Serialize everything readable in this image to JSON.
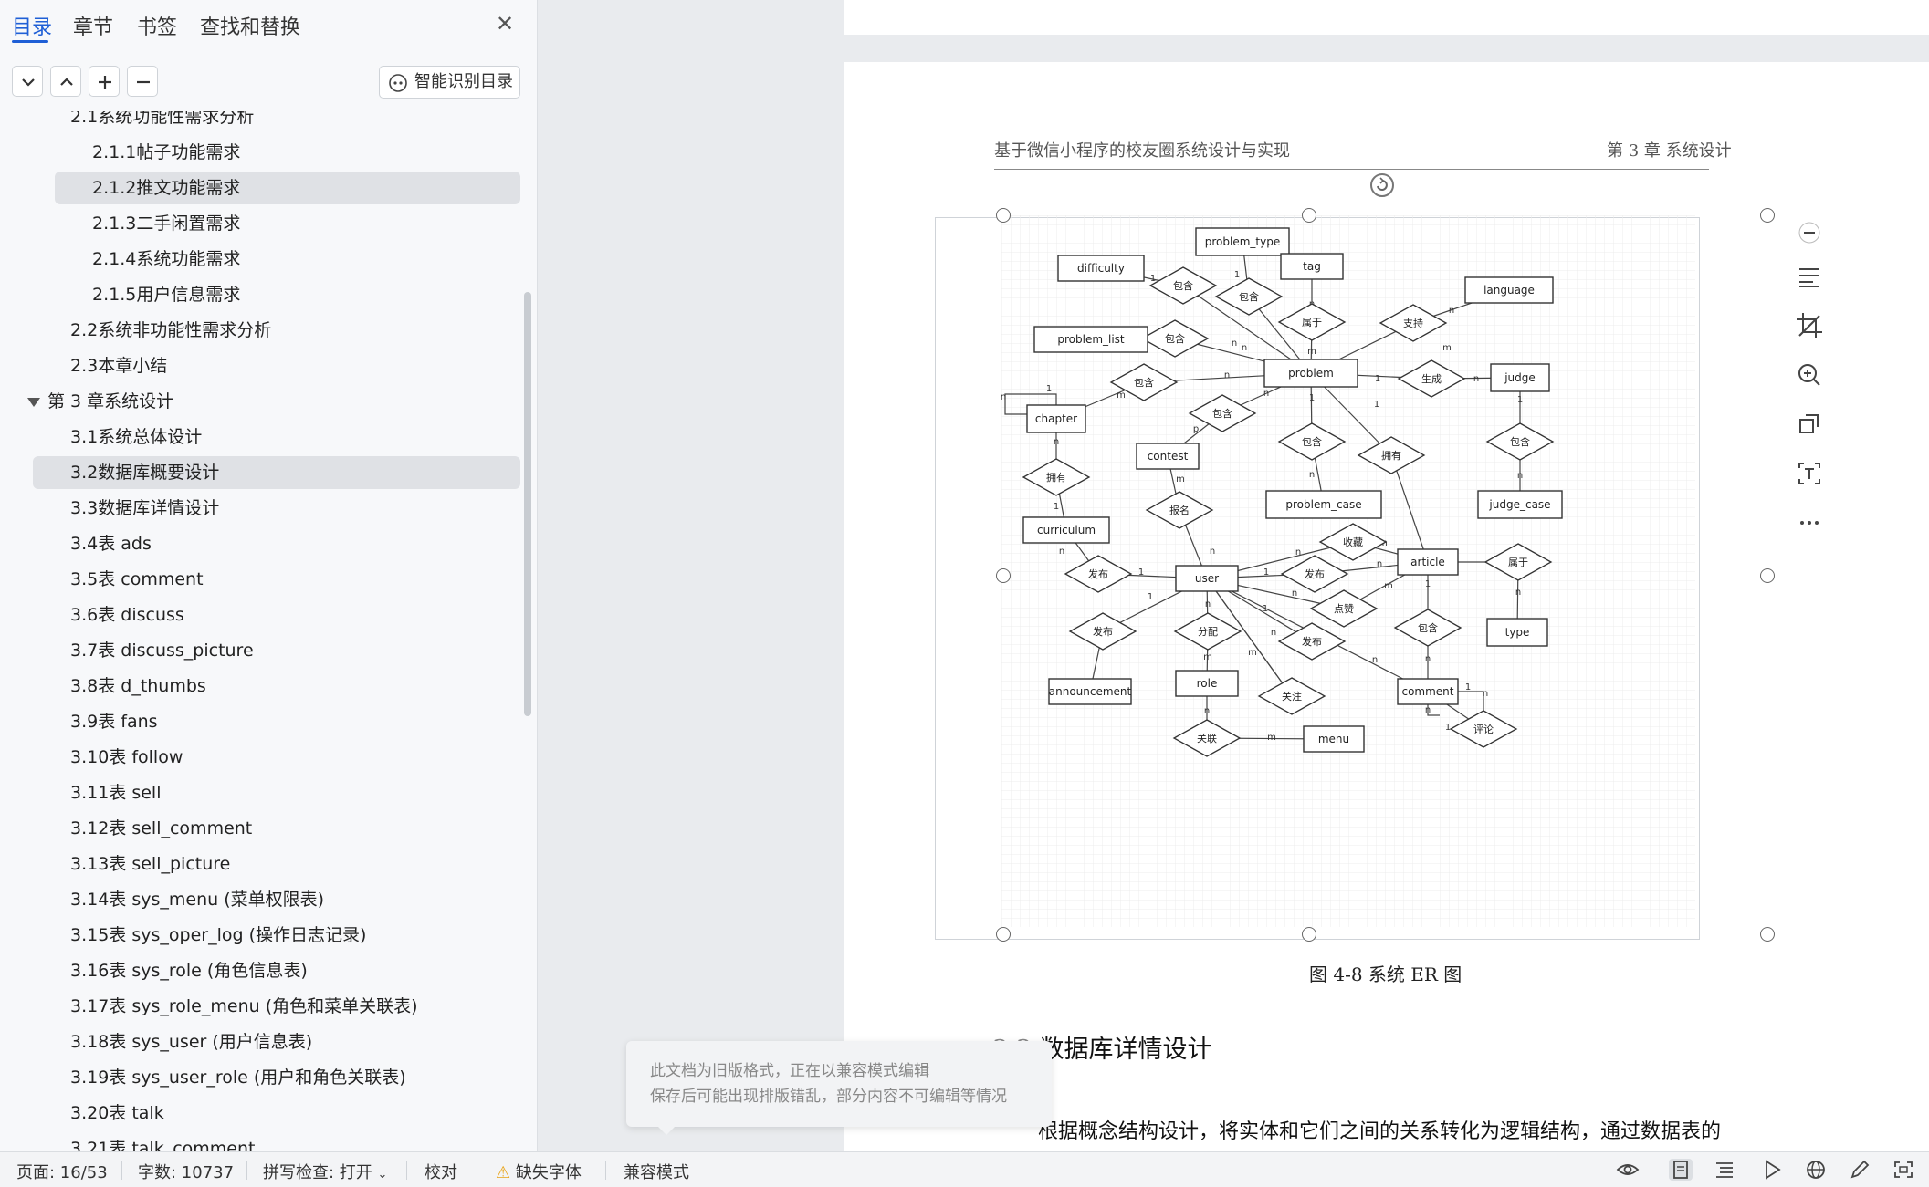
{
  "nav": {
    "tabs": [
      {
        "label": "目录",
        "active": true
      },
      {
        "label": "章节"
      },
      {
        "label": "书签"
      },
      {
        "label": "查找和替换"
      }
    ],
    "smart_button": "智能识别目录",
    "toc": [
      {
        "label": "2.1系统功能性需求分析",
        "level": 2,
        "partial": true
      },
      {
        "label": "2.1.1帖子功能需求",
        "level": 3
      },
      {
        "label": "2.1.2推文功能需求",
        "level": 3,
        "selected": true
      },
      {
        "label": "2.1.3二手闲置需求",
        "level": 3
      },
      {
        "label": "2.1.4系统功能需求",
        "level": 3
      },
      {
        "label": "2.1.5用户信息需求",
        "level": 3
      },
      {
        "label": "2.2系统非功能性需求分析",
        "level": 2
      },
      {
        "label": "2.3本章小结",
        "level": 2
      },
      {
        "label": "第 3 章系统设计",
        "level": 1,
        "expanded": true
      },
      {
        "label": "3.1系统总体设计",
        "level": 2
      },
      {
        "label": "3.2数据库概要设计",
        "level": 2,
        "selected": true
      },
      {
        "label": "3.3数据库详情设计",
        "level": 2
      },
      {
        "label": "3.4表 ads",
        "level": 2
      },
      {
        "label": "3.5表 comment",
        "level": 2
      },
      {
        "label": "3.6表 discuss",
        "level": 2
      },
      {
        "label": "3.7表 discuss_picture",
        "level": 2
      },
      {
        "label": "3.8表 d_thumbs",
        "level": 2
      },
      {
        "label": "3.9表 fans",
        "level": 2
      },
      {
        "label": "3.10表 follow",
        "level": 2
      },
      {
        "label": "3.11表 sell",
        "level": 2
      },
      {
        "label": "3.12表 sell_comment",
        "level": 2
      },
      {
        "label": "3.13表 sell_picture",
        "level": 2
      },
      {
        "label": "3.14表 sys_menu (菜单权限表)",
        "level": 2
      },
      {
        "label": "3.15表 sys_oper_log (操作日志记录)",
        "level": 2
      },
      {
        "label": "3.16表 sys_role (角色信息表)",
        "level": 2
      },
      {
        "label": "3.17表 sys_role_menu (角色和菜单关联表)",
        "level": 2
      },
      {
        "label": "3.18表 sys_user (用户信息表)",
        "level": 2
      },
      {
        "label": "3.19表 sys_user_role (用户和角色关联表)",
        "level": 2
      },
      {
        "label": "3.20表 talk",
        "level": 2
      },
      {
        "label": "3.21表 talk_comment",
        "level": 2,
        "partial": true
      }
    ]
  },
  "doc": {
    "header_left": "基于微信小程序的校友圈系统设计与实现",
    "header_right": "第 3 章  系统设计",
    "caption": "图 4-8    系统 ER 图",
    "section_num": "3.3 ",
    "section_title": "数据库详情设计",
    "body_text": "根据概念结构设计，将实体和它们之间的关系转化为逻辑结构，通过数据表的"
  },
  "er": {
    "entities": [
      {
        "id": "problem_type",
        "label": "problem_type"
      },
      {
        "id": "tag",
        "label": "tag"
      },
      {
        "id": "difficulty",
        "label": "difficulty"
      },
      {
        "id": "language",
        "label": "language"
      },
      {
        "id": "problem_list",
        "label": "problem_list"
      },
      {
        "id": "problem",
        "label": "problem"
      },
      {
        "id": "judge",
        "label": "judge"
      },
      {
        "id": "chapter",
        "label": "chapter"
      },
      {
        "id": "contest",
        "label": "contest"
      },
      {
        "id": "problem_case",
        "label": "problem_case"
      },
      {
        "id": "judge_case",
        "label": "judge_case"
      },
      {
        "id": "curriculum",
        "label": "curriculum"
      },
      {
        "id": "user",
        "label": "user"
      },
      {
        "id": "article",
        "label": "article"
      },
      {
        "id": "type",
        "label": "type"
      },
      {
        "id": "announcement",
        "label": "announcement"
      },
      {
        "id": "role",
        "label": "role"
      },
      {
        "id": "comment",
        "label": "comment"
      },
      {
        "id": "menu",
        "label": "menu"
      }
    ],
    "relations": [
      {
        "id": "r_diff",
        "label": "包含"
      },
      {
        "id": "r_ptype",
        "label": "包含"
      },
      {
        "id": "r_tag",
        "label": "属于"
      },
      {
        "id": "r_lang",
        "label": "支持"
      },
      {
        "id": "r_plist",
        "label": "包含"
      },
      {
        "id": "r_chap",
        "label": "包含"
      },
      {
        "id": "r_gen",
        "label": "生成"
      },
      {
        "id": "r_contest",
        "label": "包含"
      },
      {
        "id": "r_pcase",
        "label": "包含"
      },
      {
        "id": "r_own",
        "label": "拥有"
      },
      {
        "id": "r_jcase",
        "label": "包含"
      },
      {
        "id": "r_cown",
        "label": "拥有"
      },
      {
        "id": "r_reg",
        "label": "报名"
      },
      {
        "id": "r_fav",
        "label": "收藏"
      },
      {
        "id": "r_belong",
        "label": "属于"
      },
      {
        "id": "r_cpub",
        "label": "发布"
      },
      {
        "id": "r_apub",
        "label": "发布"
      },
      {
        "id": "r_like",
        "label": "点赞"
      },
      {
        "id": "r_anpub",
        "label": "发布"
      },
      {
        "id": "r_assign",
        "label": "分配"
      },
      {
        "id": "r_cmpub",
        "label": "发布"
      },
      {
        "id": "r_artc",
        "label": "包含"
      },
      {
        "id": "r_follow",
        "label": "关注"
      },
      {
        "id": "r_review",
        "label": "评论"
      },
      {
        "id": "r_assoc",
        "label": "关联"
      }
    ]
  },
  "tooltip": {
    "line1": "此文档为旧版格式，正在以兼容模式编辑",
    "line2": "保存后可能出现排版错乱，部分内容不可编辑等情况"
  },
  "status": {
    "page": "页面: 16/53",
    "words": "字数: 10737",
    "spell": "拼写检查: 打开",
    "proof": "校对",
    "missing_font": "缺失字体",
    "compat": "兼容模式"
  }
}
